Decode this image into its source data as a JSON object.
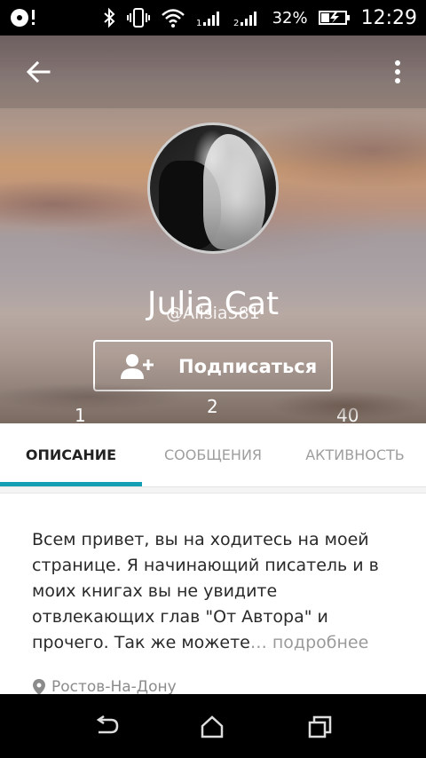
{
  "status_bar": {
    "battery_percent": "32%",
    "time": "12:29",
    "icons": [
      "media-icon",
      "bluetooth-icon",
      "vibrate-icon",
      "wifi-icon",
      "signal-1-icon",
      "signal-2-icon",
      "battery-charging-icon"
    ]
  },
  "profile": {
    "name": "Julia Cat",
    "handle": "@Alisia581",
    "subscribe_label": "Подписаться",
    "stats": [
      "1",
      "2",
      "40"
    ]
  },
  "tabs": [
    {
      "label": "ОПИСАНИЕ",
      "active": true
    },
    {
      "label": "СООБЩЕНИЯ",
      "active": false
    },
    {
      "label": "АКТИВНОСТЬ",
      "active": false
    }
  ],
  "description": {
    "text": "Всем привет, вы на ходитесь на моей странице. Я начинающий писатель и в моих книгах вы не увидите отвлекающих глав \"От Автора\" и прочего. Так же можете",
    "ellipsis": "…",
    "more_label": " подробнее",
    "location": "Ростов-На-Дону"
  },
  "colors": {
    "accent": "#139fb3",
    "tab_inactive": "#9e9e9e",
    "text_main": "#2a2a2a"
  },
  "nav_bar": {
    "icons": [
      "back-nav-icon",
      "home-nav-icon",
      "recent-apps-icon"
    ]
  }
}
